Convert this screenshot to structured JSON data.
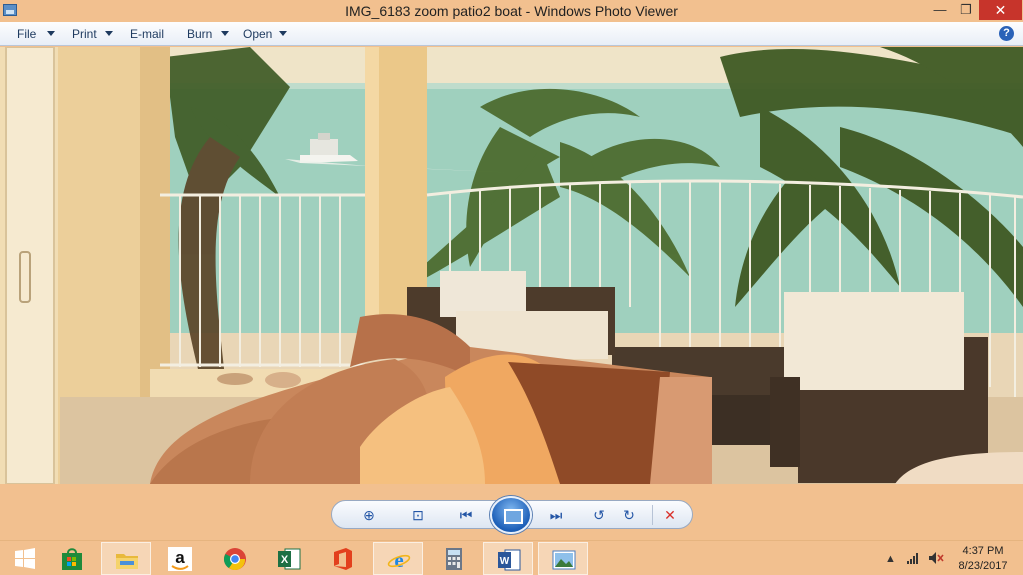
{
  "window": {
    "title": "IMG_6183 zoom patio2 boat - Windows Photo Viewer",
    "minimize_glyph": "—",
    "maximize_glyph": "❐",
    "close_glyph": "✕"
  },
  "menu": {
    "items": [
      {
        "label": "File",
        "has_dropdown": true
      },
      {
        "label": "Print",
        "has_dropdown": true
      },
      {
        "label": "E-mail",
        "has_dropdown": false
      },
      {
        "label": "Burn",
        "has_dropdown": true
      },
      {
        "label": "Open",
        "has_dropdown": true
      }
    ],
    "help_glyph": "?"
  },
  "photo": {
    "icon": "photo-of-balcony-patio-with-ocean-view",
    "sky_color": "#efe4c8",
    "sea_color": "#9fd0be",
    "wall_color": "#eccf9a"
  },
  "controls": {
    "zoom_glyph": "⊕",
    "actual_size_glyph": "⊡",
    "previous_glyph": "⏮",
    "next_glyph": "⏭",
    "rotate_ccw_glyph": "↺",
    "rotate_cw_glyph": "↻",
    "delete_glyph": "✕",
    "delete_color": "#d9302a"
  },
  "taskbar": {
    "apps": [
      {
        "name": "store-icon",
        "active": false
      },
      {
        "name": "file-explorer-icon",
        "active": true
      },
      {
        "name": "amazon-icon",
        "active": false
      },
      {
        "name": "chrome-icon",
        "active": false
      },
      {
        "name": "excel-icon",
        "active": false
      },
      {
        "name": "office-icon",
        "active": false
      },
      {
        "name": "internet-explorer-icon",
        "active": true
      },
      {
        "name": "calculator-icon",
        "active": false
      },
      {
        "name": "word-icon",
        "active": true
      },
      {
        "name": "photo-viewer-icon",
        "active": true
      }
    ],
    "time": "4:37 PM",
    "date": "8/23/2017",
    "tray_arrow_glyph": "▲",
    "volume_muted_glyph": "✕"
  }
}
